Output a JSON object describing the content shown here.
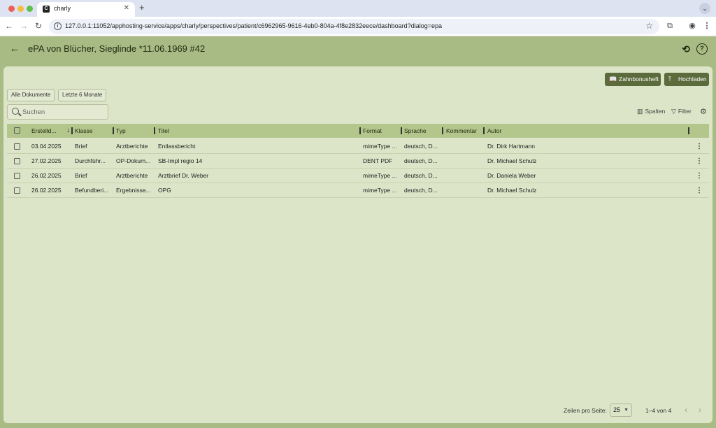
{
  "browser": {
    "tab_title": "charly",
    "tab_favicon": "C",
    "url": "127.0.0.1:11052/apphosting-service/apps/charly/perspectives/patient/c6962965-9616-4eb0-804a-4f8e2832eece/dashboard?dialog=epa"
  },
  "header": {
    "title": "ePA von Blücher, Sieglinde *11.06.1969 #42"
  },
  "actions": {
    "zahnbonusheft": "Zahnbonusheft",
    "hochladen": "Hochladen"
  },
  "filters": {
    "chips": [
      "Alle Dokumente",
      "Letzte 6 Monate"
    ],
    "search_placeholder": "Suchen",
    "spalten": "Spalten",
    "filter": "Filter"
  },
  "table": {
    "columns": [
      "Erstelld...",
      "Klasse",
      "Typ",
      "Titel",
      "Format",
      "Sprache",
      "Kommentar",
      "Autor"
    ],
    "rows": [
      [
        "03.04.2025",
        "Brief",
        "Arztberichte",
        "Entlassbericht",
        "mimeType ...",
        "deutsch, D...",
        "",
        "Dr. Dirk Hartmann"
      ],
      [
        "27.02.2025",
        "Durchführ...",
        "OP-Dokum...",
        "SB-Impl regio 14",
        "DENT PDF",
        "deutsch, D...",
        "",
        "Dr. Michael Schulz"
      ],
      [
        "26.02.2025",
        "Brief",
        "Arztberichte",
        "Arztbrief Dr. Weber",
        "mimeType ...",
        "deutsch, D...",
        "",
        "Dr. Daniela Weber"
      ],
      [
        "26.02.2025",
        "Befundberi...",
        "Ergebnisse...",
        "OPG",
        "mimeType ...",
        "deutsch, D...",
        "",
        "Dr. Michael Schulz"
      ]
    ]
  },
  "pagination": {
    "rows_per_page_label": "Zeilen pro Seite:",
    "rows_per_page": "25",
    "range": "1–4 von 4"
  },
  "icons": {
    "back": "arrow-left-icon",
    "history": "history-icon",
    "help": "help-icon",
    "book": "book-icon",
    "upload": "upload-icon",
    "columns": "columns-icon",
    "filter": "filter-icon",
    "settings": "gear-icon"
  }
}
